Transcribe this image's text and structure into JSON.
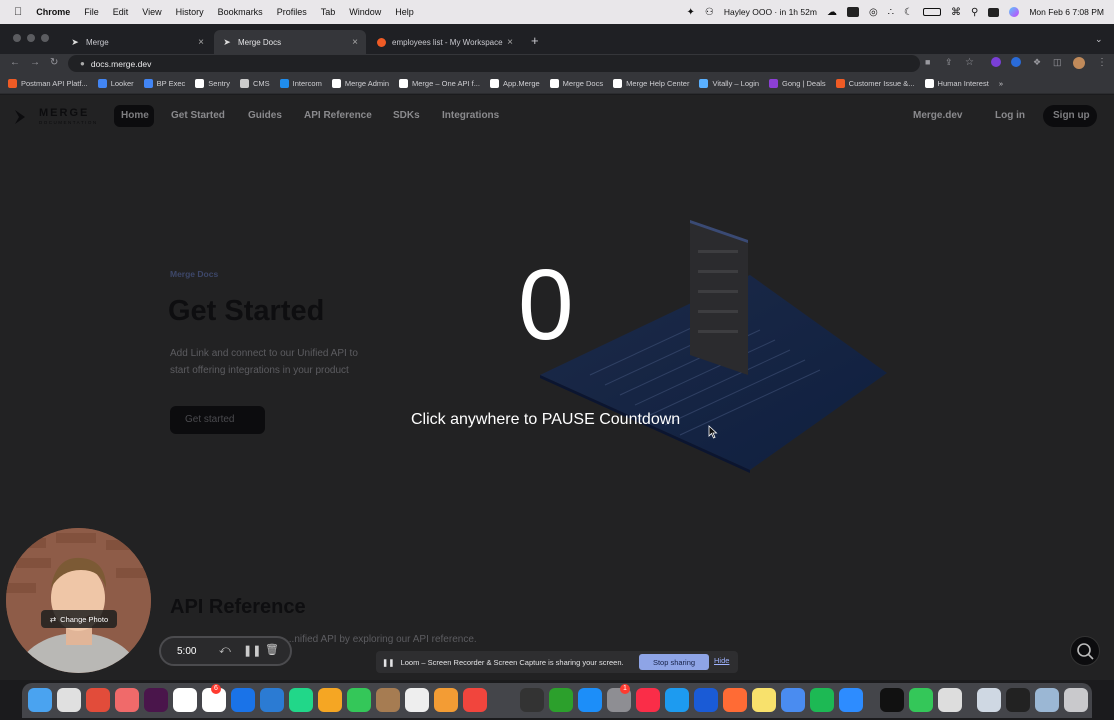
{
  "menubar": {
    "app": "Chrome",
    "items": [
      "File",
      "Edit",
      "View",
      "History",
      "Bookmarks",
      "Profiles",
      "Tab",
      "Window",
      "Help"
    ],
    "status_text": "Hayley OOO · in 1h 52m",
    "clock": "Mon Feb 6  7:08 PM"
  },
  "tabs": [
    {
      "title": "Merge",
      "favicon": "merge-logo-icon"
    },
    {
      "title": "Merge Docs",
      "favicon": "merge-logo-icon"
    },
    {
      "title": "employees list - My Workspace",
      "favicon": "postman-icon"
    }
  ],
  "address": {
    "url": "docs.merge.dev"
  },
  "bookmarks": [
    {
      "label": "Postman API Platf...",
      "color": "#ef5b25"
    },
    {
      "label": "Looker",
      "color": "#4285f4"
    },
    {
      "label": "BP Exec",
      "color": "#4285f4"
    },
    {
      "label": "Sentry",
      "color": "#ffffff"
    },
    {
      "label": "CMS",
      "color": "#cccccc"
    },
    {
      "label": "Intercom",
      "color": "#1f8ded"
    },
    {
      "label": "Merge Admin",
      "color": "#ffffff"
    },
    {
      "label": "Merge – One API f...",
      "color": "#ffffff"
    },
    {
      "label": "App.Merge",
      "color": "#ffffff"
    },
    {
      "label": "Merge Docs",
      "color": "#ffffff"
    },
    {
      "label": "Merge Help Center",
      "color": "#ffffff"
    },
    {
      "label": "Vitally – Login",
      "color": "#5ab0ff"
    },
    {
      "label": "Gong | Deals",
      "color": "#8c3fd6"
    },
    {
      "label": "Customer Issue &...",
      "color": "#ef5b25"
    },
    {
      "label": "Human Interest",
      "color": "#ffffff"
    }
  ],
  "site": {
    "logo_main": "MERGE",
    "logo_sub": "DOCUMENTATION",
    "nav": [
      "Home",
      "Get Started",
      "Guides",
      "API Reference",
      "SDKs",
      "Integrations"
    ],
    "right_nav": {
      "link": "Merge.dev",
      "login": "Log in",
      "signup": "Sign up"
    }
  },
  "hero": {
    "label": "Merge Docs",
    "title": "Get Started",
    "subtitle_line1": "Add Link and connect to our Unified API to",
    "subtitle_line2": "start offering integrations in your product",
    "button": "Get started"
  },
  "section2": {
    "title": "API Reference",
    "subtitle": "...nified API by exploring our API reference."
  },
  "overlay": {
    "countdown": "0",
    "message": "Click anywhere to PAUSE Countdown"
  },
  "camera": {
    "change_photo": "Change Photo"
  },
  "timer": {
    "time": "5:00"
  },
  "loom": {
    "message": "Loom – Screen Recorder & Screen Capture is sharing your screen.",
    "stop": "Stop sharing",
    "hide": "Hide"
  },
  "dock": {
    "badge_1": "6",
    "badge_2": "1"
  }
}
